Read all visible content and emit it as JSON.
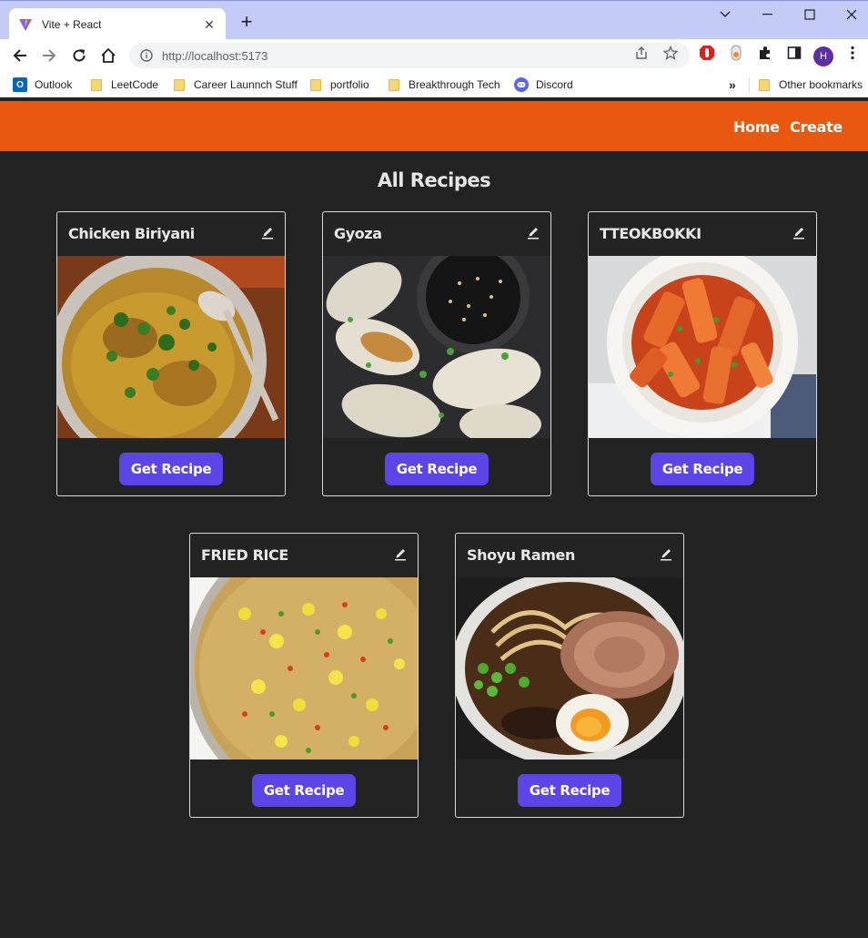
{
  "browser": {
    "tab_title": "Vite + React",
    "url": "http://localhost:5173",
    "avatar_letter": "H",
    "bookmarks": [
      {
        "label": "Outlook",
        "icon": "outlook-icon"
      },
      {
        "label": "LeetCode",
        "icon": "folder-icon"
      },
      {
        "label": "Career Launnch Stuff",
        "icon": "folder-icon"
      },
      {
        "label": "portfolio",
        "icon": "folder-icon"
      },
      {
        "label": "Breakthrough Tech",
        "icon": "folder-icon"
      },
      {
        "label": "Discord",
        "icon": "discord-icon"
      }
    ],
    "overflow_label": "»",
    "other_bookmarks": "Other bookmarks"
  },
  "nav": {
    "home": "Home",
    "create": "Create"
  },
  "page": {
    "title": "All Recipes"
  },
  "recipes": [
    {
      "name": "Chicken Biriyani",
      "button": "Get Recipe"
    },
    {
      "name": "Gyoza",
      "button": "Get Recipe"
    },
    {
      "name": "TTEOKBOKKI",
      "button": "Get Recipe"
    },
    {
      "name": "FRIED RICE",
      "button": "Get Recipe"
    },
    {
      "name": "Shoyu Ramen",
      "button": "Get Recipe"
    }
  ],
  "colors": {
    "navbar": "#e8580f",
    "background": "#222222",
    "button": "#5b45e6"
  }
}
